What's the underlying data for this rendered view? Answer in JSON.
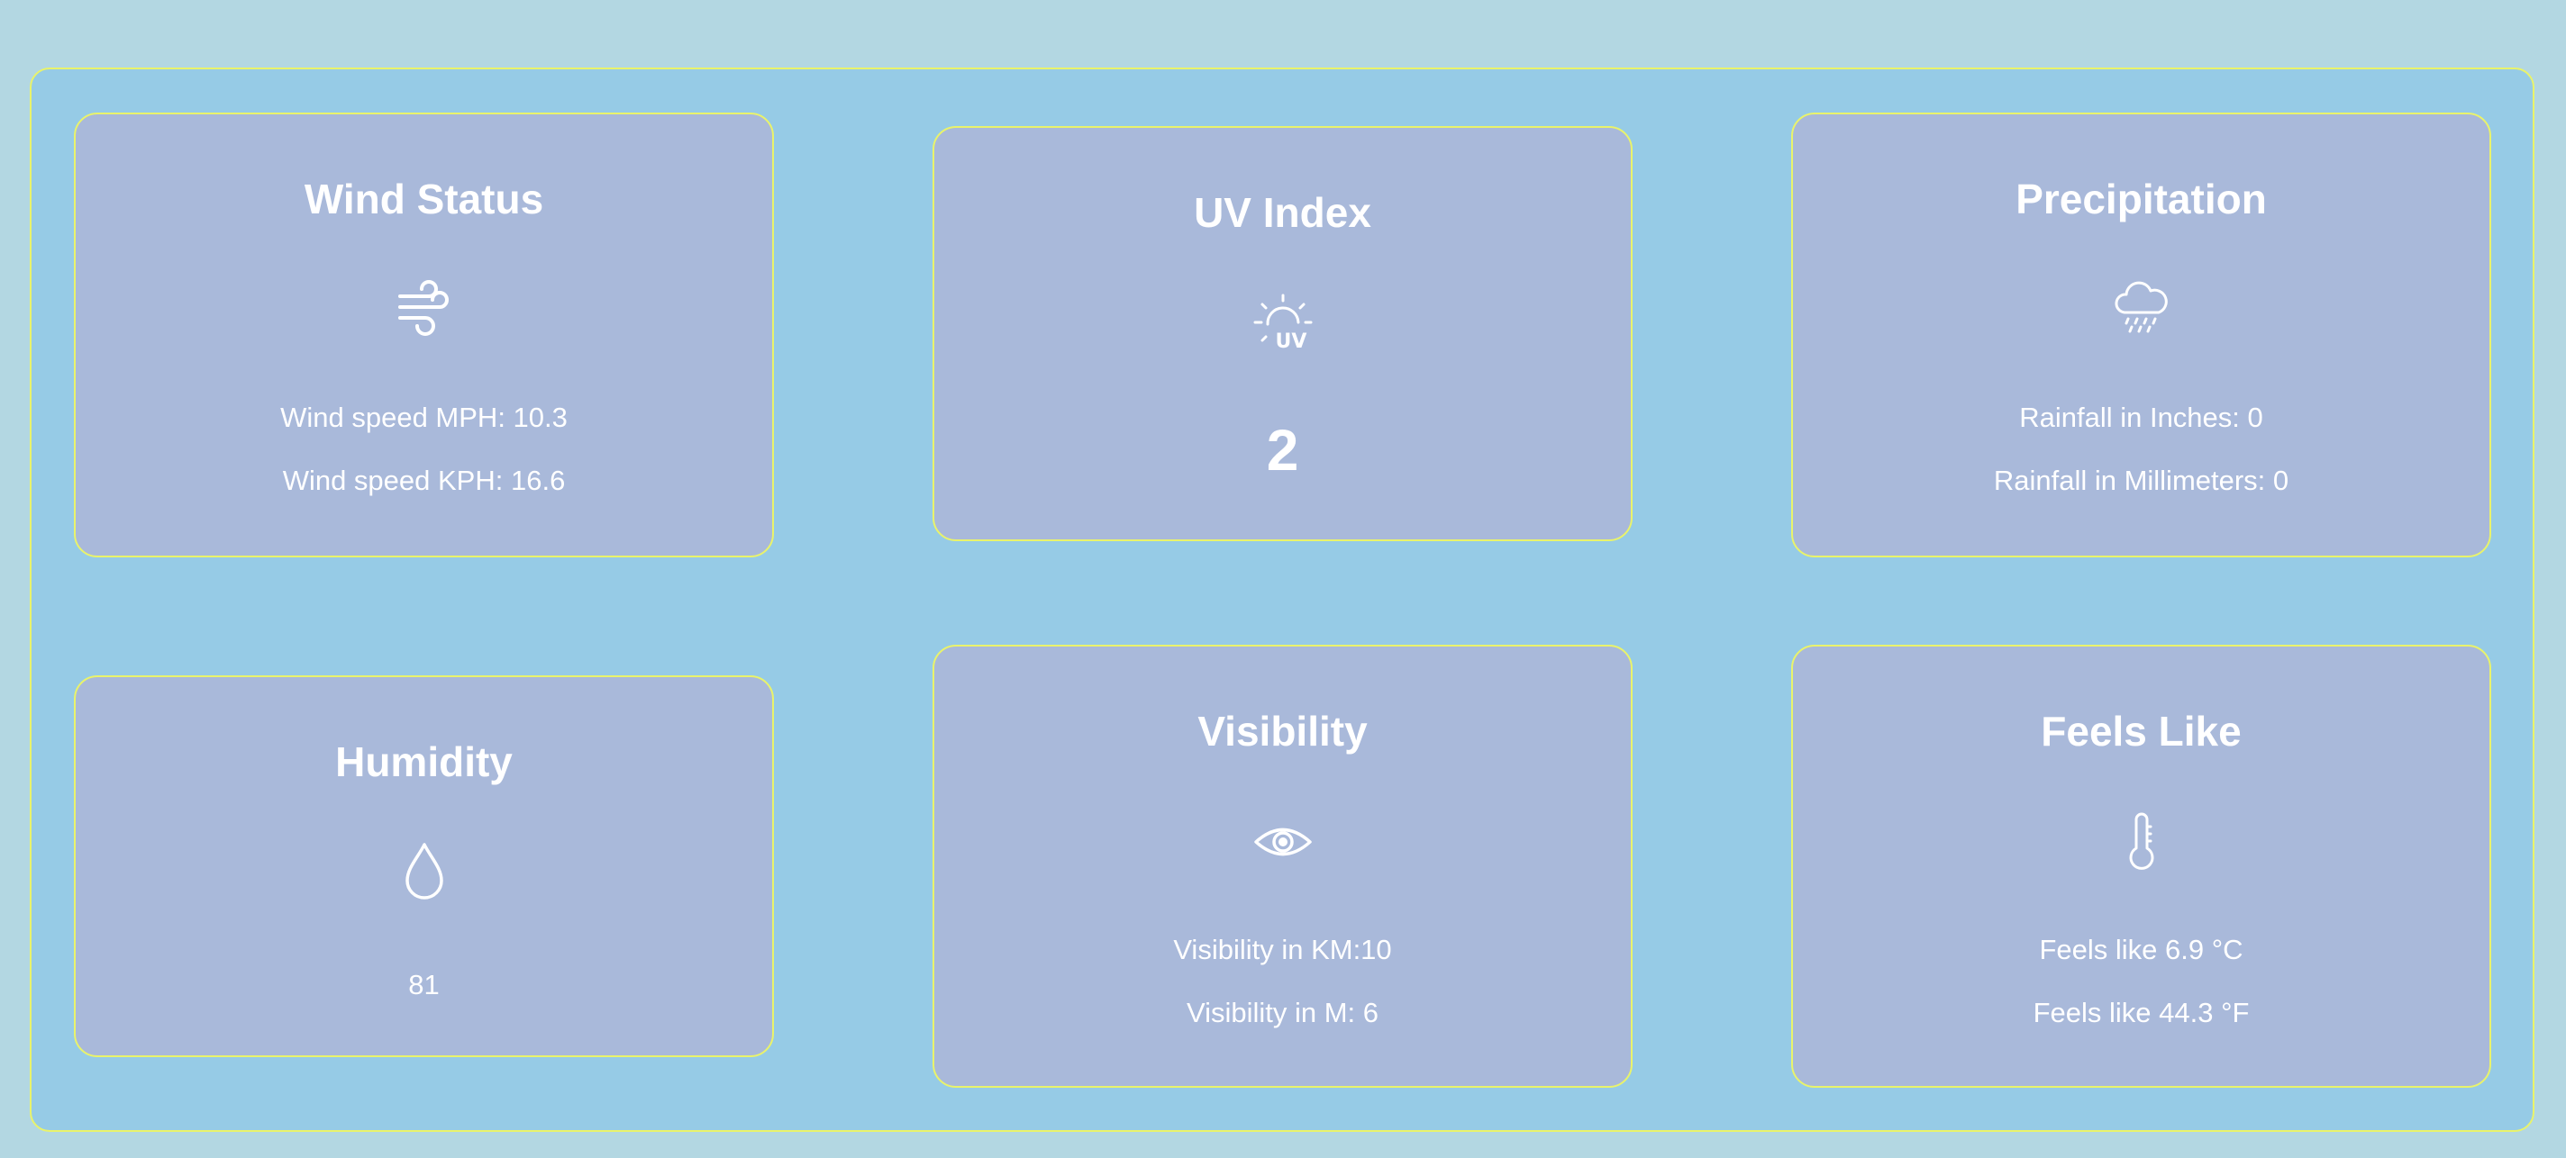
{
  "cards": {
    "wind": {
      "title": "Wind Status",
      "icon": "wind-icon",
      "mph": "Wind speed MPH: 10.3",
      "kph": "Wind speed KPH: 16.6"
    },
    "uv": {
      "title": "UV Index",
      "icon": "uv-sun-icon",
      "value": "2"
    },
    "precipitation": {
      "title": "Precipitation",
      "icon": "rain-cloud-icon",
      "inches": "Rainfall in Inches: 0",
      "mm": "Rainfall in Millimeters: 0"
    },
    "humidity": {
      "title": "Humidity",
      "icon": "water-drop-icon",
      "value": "81"
    },
    "visibility": {
      "title": "Visibility",
      "icon": "eye-icon",
      "km": "Visibility in KM:10",
      "m": "Visibility in M: 6"
    },
    "feels_like": {
      "title": "Feels Like",
      "icon": "thermometer-icon",
      "celsius": "Feels like 6.9 °C",
      "fahrenheit": "Feels like 44.3 °F"
    }
  },
  "colors": {
    "page_background": "#b3d7e2",
    "panel_background": "#96cbe6",
    "card_background": "#a9b9da",
    "border_accent": "#e9f36b",
    "text": "#ffffff"
  }
}
